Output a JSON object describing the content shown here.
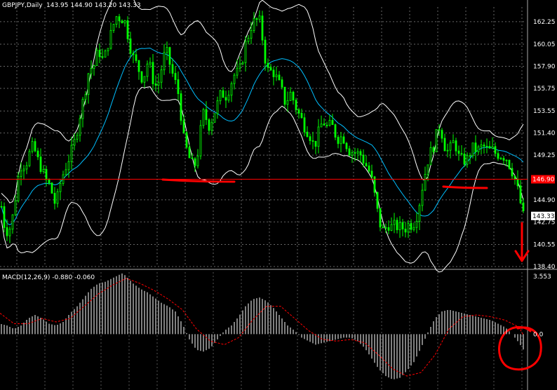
{
  "chart_data": [
    {
      "type": "candlestick",
      "header": {
        "symbol": "GBPJPY,Daily",
        "ohlc": "143.95 144.90 143.20 143.33"
      },
      "y_ticks": [
        "162.25",
        "160.05",
        "157.90",
        "155.75",
        "153.55",
        "151.40",
        "149.25",
        "144.90",
        "142.75",
        "140.55",
        "138.40"
      ],
      "ylim": [
        138.4,
        163.4
      ],
      "current_price_label": "143.33",
      "current_price": 143.33,
      "hline_price": 146.9,
      "hline_label": "146.90",
      "colors": {
        "bull": "#00ff00",
        "bear": "#00ff00",
        "candle_stroke": "#00ff00",
        "middle_band": "#00bfff",
        "bands": "#ffffff",
        "hline": "#ff0000",
        "annotation": "#ff0000"
      },
      "price_path": [
        [
          0,
          145.5
        ],
        [
          4,
          143.0
        ],
        [
          8,
          142.0
        ],
        [
          12,
          141.8
        ],
        [
          16,
          142.5
        ],
        [
          20,
          144.0
        ],
        [
          24,
          146.2
        ],
        [
          28,
          148.0
        ],
        [
          32,
          148.5
        ],
        [
          36,
          148.2
        ],
        [
          40,
          149.0
        ],
        [
          44,
          149.8
        ],
        [
          48,
          150.2
        ],
        [
          52,
          149.0
        ],
        [
          56,
          148.5
        ],
        [
          60,
          147.8
        ],
        [
          64,
          147.0
        ],
        [
          68,
          146.5
        ],
        [
          72,
          146.2
        ],
        [
          76,
          145.0
        ],
        [
          80,
          144.3
        ],
        [
          84,
          146.0
        ],
        [
          88,
          147.0
        ],
        [
          92,
          147.8
        ],
        [
          96,
          148.5
        ],
        [
          100,
          149.3
        ],
        [
          104,
          150.0
        ],
        [
          108,
          151.0
        ],
        [
          112,
          152.5
        ],
        [
          116,
          153.8
        ],
        [
          120,
          155.0
        ],
        [
          124,
          156.5
        ],
        [
          128,
          158.0
        ],
        [
          132,
          157.5
        ],
        [
          136,
          158.5
        ],
        [
          140,
          159.5
        ],
        [
          144,
          159.0
        ],
        [
          148,
          158.2
        ],
        [
          152,
          159.8
        ],
        [
          156,
          160.5
        ],
        [
          160,
          161.5
        ],
        [
          164,
          162.5
        ],
        [
          168,
          163.0
        ],
        [
          172,
          162.3
        ],
        [
          176,
          162.8
        ],
        [
          180,
          161.6
        ],
        [
          184,
          160.5
        ],
        [
          188,
          159.0
        ],
        [
          192,
          158.5
        ],
        [
          196,
          157.9
        ],
        [
          200,
          157.2
        ],
        [
          204,
          156.5
        ],
        [
          208,
          157.8
        ],
        [
          212,
          158.6
        ],
        [
          216,
          157.0
        ],
        [
          220,
          156.3
        ],
        [
          224,
          155.8
        ],
        [
          228,
          157.0
        ],
        [
          232,
          158.3
        ],
        [
          236,
          159.5
        ],
        [
          240,
          158.8
        ],
        [
          244,
          157.5
        ],
        [
          248,
          156.8
        ],
        [
          252,
          155.8
        ],
        [
          256,
          154.8
        ],
        [
          260,
          151.5
        ],
        [
          264,
          150.2
        ],
        [
          268,
          149.4
        ],
        [
          272,
          148.5
        ],
        [
          276,
          148.2
        ],
        [
          280,
          148.5
        ],
        [
          284,
          150.5
        ],
        [
          288,
          152.8
        ],
        [
          292,
          153.8
        ],
        [
          296,
          151.8
        ],
        [
          300,
          152.5
        ],
        [
          304,
          153.0
        ],
        [
          308,
          154.0
        ],
        [
          312,
          154.5
        ],
        [
          316,
          155.6
        ],
        [
          320,
          154.8
        ],
        [
          324,
          155.3
        ],
        [
          328,
          156.0
        ],
        [
          332,
          156.8
        ],
        [
          336,
          157.3
        ],
        [
          340,
          157.2
        ],
        [
          344,
          158.0
        ],
        [
          348,
          159.5
        ],
        [
          352,
          160.6
        ],
        [
          356,
          161.2
        ],
        [
          360,
          162.4
        ],
        [
          364,
          162.0
        ],
        [
          368,
          162.7
        ],
        [
          372,
          161.8
        ],
        [
          376,
          159.5
        ],
        [
          380,
          157.8
        ],
        [
          384,
          157.2
        ],
        [
          388,
          157.6
        ],
        [
          392,
          157.0
        ],
        [
          396,
          156.5
        ],
        [
          400,
          155.8
        ],
        [
          404,
          155.0
        ],
        [
          408,
          154.0
        ],
        [
          412,
          155.5
        ],
        [
          416,
          155.0
        ],
        [
          420,
          154.3
        ],
        [
          424,
          153.5
        ],
        [
          428,
          153.0
        ],
        [
          432,
          152.4
        ],
        [
          436,
          151.8
        ],
        [
          440,
          151.5
        ],
        [
          444,
          150.8
        ],
        [
          448,
          150.0
        ],
        [
          452,
          151.0
        ],
        [
          456,
          151.8
        ],
        [
          460,
          152.6
        ],
        [
          464,
          152.2
        ],
        [
          468,
          151.8
        ],
        [
          472,
          152.4
        ],
        [
          476,
          151.6
        ],
        [
          480,
          151.0
        ],
        [
          484,
          150.8
        ],
        [
          488,
          151.2
        ],
        [
          492,
          150.6
        ],
        [
          496,
          150.0
        ],
        [
          500,
          149.4
        ],
        [
          504,
          149.8
        ],
        [
          508,
          149.2
        ],
        [
          512,
          149.6
        ],
        [
          516,
          149.0
        ],
        [
          520,
          148.5
        ],
        [
          524,
          148.0
        ],
        [
          528,
          147.4
        ],
        [
          532,
          146.2
        ],
        [
          536,
          144.5
        ],
        [
          540,
          143.0
        ],
        [
          544,
          142.0
        ],
        [
          548,
          141.8
        ],
        [
          552,
          142.6
        ],
        [
          556,
          142.4
        ],
        [
          560,
          142.1
        ],
        [
          564,
          142.6
        ],
        [
          568,
          142.0
        ],
        [
          572,
          142.4
        ],
        [
          576,
          141.9
        ],
        [
          580,
          142.4
        ],
        [
          584,
          142.6
        ],
        [
          588,
          142.4
        ],
        [
          592,
          143.0
        ],
        [
          596,
          143.8
        ],
        [
          600,
          145.5
        ],
        [
          604,
          146.8
        ],
        [
          608,
          148.2
        ],
        [
          612,
          149.3
        ],
        [
          616,
          149.8
        ],
        [
          620,
          150.5
        ],
        [
          624,
          151.8
        ],
        [
          628,
          152.2
        ],
        [
          632,
          150.5
        ],
        [
          636,
          149.8
        ],
        [
          640,
          149.5
        ],
        [
          644,
          150.3
        ],
        [
          648,
          150.6
        ],
        [
          652,
          149.6
        ],
        [
          656,
          148.6
        ],
        [
          660,
          149.0
        ],
        [
          664,
          148.5
        ],
        [
          668,
          149.2
        ],
        [
          672,
          149.8
        ],
        [
          676,
          150.0
        ],
        [
          680,
          149.6
        ],
        [
          684,
          149.9
        ],
        [
          688,
          150.1
        ],
        [
          692,
          150.0
        ],
        [
          696,
          149.6
        ],
        [
          700,
          149.8
        ],
        [
          704,
          149.7
        ],
        [
          708,
          149.2
        ],
        [
          712,
          149.5
        ],
        [
          716,
          149.0
        ],
        [
          720,
          149.3
        ],
        [
          724,
          148.6
        ],
        [
          728,
          148.1
        ],
        [
          732,
          147.3
        ],
        [
          736,
          146.5
        ],
        [
          740,
          145.2
        ],
        [
          744,
          144.0
        ],
        [
          746,
          143.33
        ]
      ]
    },
    {
      "type": "macd",
      "header": "MACD(12,26,9) -0.880 -0.060",
      "y_ticks_top": "3.553",
      "zero_label": "0.0",
      "ylim": [
        -3.2,
        3.553
      ],
      "colors": {
        "histogram": "#ffffff",
        "signal": "#ff0000"
      },
      "macd_path": [
        [
          0,
          0.6
        ],
        [
          10,
          0.5
        ],
        [
          20,
          0.3
        ],
        [
          30,
          0.5
        ],
        [
          40,
          0.9
        ],
        [
          50,
          1.1
        ],
        [
          60,
          0.9
        ],
        [
          70,
          0.6
        ],
        [
          80,
          0.5
        ],
        [
          90,
          0.7
        ],
        [
          100,
          1.2
        ],
        [
          110,
          1.6
        ],
        [
          120,
          2.1
        ],
        [
          130,
          2.6
        ],
        [
          140,
          2.9
        ],
        [
          150,
          3.0
        ],
        [
          160,
          3.2
        ],
        [
          170,
          3.4
        ],
        [
          175,
          3.5
        ],
        [
          180,
          3.3
        ],
        [
          190,
          2.9
        ],
        [
          200,
          2.6
        ],
        [
          210,
          2.4
        ],
        [
          220,
          2.1
        ],
        [
          230,
          1.8
        ],
        [
          240,
          1.6
        ],
        [
          250,
          1.3
        ],
        [
          260,
          0.6
        ],
        [
          270,
          -0.3
        ],
        [
          280,
          -0.9
        ],
        [
          290,
          -1.0
        ],
        [
          300,
          -0.8
        ],
        [
          310,
          -0.3
        ],
        [
          320,
          0.2
        ],
        [
          330,
          0.5
        ],
        [
          340,
          1.0
        ],
        [
          350,
          1.6
        ],
        [
          360,
          2.0
        ],
        [
          370,
          2.1
        ],
        [
          380,
          1.9
        ],
        [
          390,
          1.5
        ],
        [
          400,
          1.0
        ],
        [
          410,
          0.5
        ],
        [
          420,
          0.2
        ],
        [
          430,
          -0.2
        ],
        [
          440,
          -0.4
        ],
        [
          450,
          -0.6
        ],
        [
          460,
          -0.5
        ],
        [
          470,
          -0.4
        ],
        [
          480,
          -0.3
        ],
        [
          490,
          -0.2
        ],
        [
          500,
          -0.2
        ],
        [
          510,
          -0.4
        ],
        [
          520,
          -0.8
        ],
        [
          530,
          -1.4
        ],
        [
          540,
          -2.0
        ],
        [
          550,
          -2.4
        ],
        [
          560,
          -2.6
        ],
        [
          570,
          -2.5
        ],
        [
          580,
          -2.1
        ],
        [
          590,
          -1.6
        ],
        [
          600,
          -0.8
        ],
        [
          610,
          0.1
        ],
        [
          620,
          0.9
        ],
        [
          630,
          1.3
        ],
        [
          640,
          1.4
        ],
        [
          650,
          1.3
        ],
        [
          660,
          1.2
        ],
        [
          670,
          1.1
        ],
        [
          680,
          1.0
        ],
        [
          690,
          0.9
        ],
        [
          700,
          0.8
        ],
        [
          710,
          0.6
        ],
        [
          720,
          0.4
        ],
        [
          730,
          0.0
        ],
        [
          740,
          -0.5
        ],
        [
          746,
          -0.88
        ]
      ],
      "signal_path": [
        [
          0,
          1.2
        ],
        [
          20,
          0.6
        ],
        [
          40,
          0.6
        ],
        [
          60,
          0.9
        ],
        [
          80,
          0.7
        ],
        [
          100,
          0.9
        ],
        [
          120,
          1.6
        ],
        [
          140,
          2.3
        ],
        [
          160,
          2.8
        ],
        [
          180,
          3.2
        ],
        [
          200,
          2.9
        ],
        [
          220,
          2.5
        ],
        [
          240,
          2.0
        ],
        [
          260,
          1.4
        ],
        [
          280,
          0.3
        ],
        [
          300,
          -0.4
        ],
        [
          320,
          -0.6
        ],
        [
          340,
          -0.2
        ],
        [
          360,
          0.8
        ],
        [
          380,
          1.6
        ],
        [
          400,
          1.6
        ],
        [
          420,
          0.9
        ],
        [
          440,
          0.2
        ],
        [
          460,
          -0.3
        ],
        [
          480,
          -0.4
        ],
        [
          500,
          -0.3
        ],
        [
          520,
          -0.5
        ],
        [
          540,
          -1.2
        ],
        [
          560,
          -2.0
        ],
        [
          580,
          -2.4
        ],
        [
          600,
          -2.2
        ],
        [
          620,
          -1.2
        ],
        [
          640,
          0.3
        ],
        [
          660,
          1.0
        ],
        [
          680,
          1.1
        ],
        [
          700,
          1.0
        ],
        [
          720,
          0.8
        ],
        [
          740,
          0.4
        ],
        [
          746,
          -0.06
        ]
      ]
    }
  ]
}
